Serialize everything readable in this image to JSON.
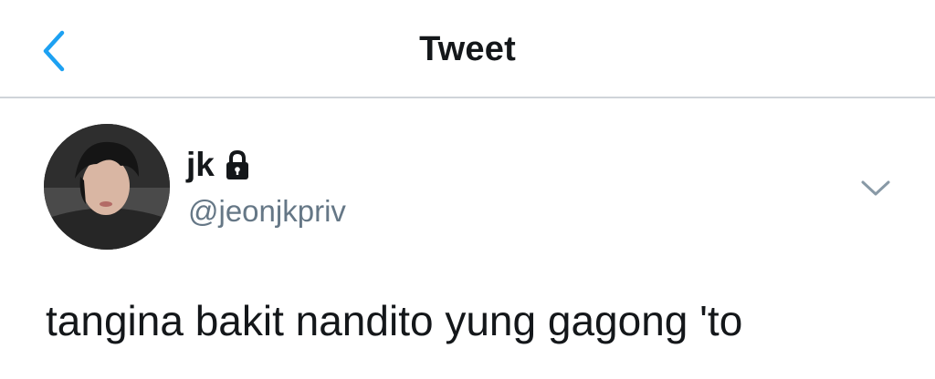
{
  "header": {
    "title": "Tweet",
    "back_icon": "chevron-left-icon",
    "accent_color": "#1da1f2"
  },
  "tweet": {
    "author": {
      "display_name": "jk",
      "handle": "@jeonjkpriv",
      "protected_icon": "lock-icon"
    },
    "menu_icon": "chevron-down-icon",
    "text": "tangina bakit nandito yung gagong 'to"
  }
}
